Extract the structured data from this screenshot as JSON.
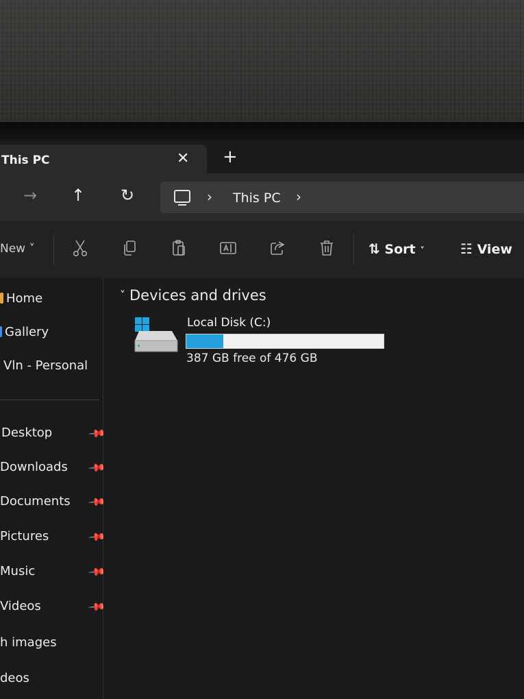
{
  "tab": {
    "title": "This PC",
    "close": "✕",
    "new_tab": "+"
  },
  "nav": {
    "forward": "→",
    "up": "↑",
    "refresh": "↻"
  },
  "address": {
    "crumb": "This PC",
    "sep": "›"
  },
  "commands": {
    "new_label": "New ˅",
    "sort_label": "Sort",
    "view_label": "View"
  },
  "sidebar": {
    "top": [
      {
        "label": "Home",
        "icon": "home-icon",
        "color": "#e8a43a"
      },
      {
        "label": "Gallery",
        "icon": "gallery-icon",
        "color": "#3a8ee8"
      },
      {
        "label": "Vln - Personal",
        "icon": "cloud-icon",
        "color": "#3a8ee8"
      }
    ],
    "pinned": [
      {
        "label": "Desktop"
      },
      {
        "label": "Downloads"
      },
      {
        "label": "Documents"
      },
      {
        "label": "Pictures"
      },
      {
        "label": "Music"
      },
      {
        "label": "Videos"
      },
      {
        "label": "h images"
      },
      {
        "label": "deos"
      }
    ]
  },
  "content": {
    "group_title": "Devices and drives",
    "drive": {
      "name": "Local Disk (C:)",
      "free_text": "387 GB free of 476 GB",
      "used_fraction": 0.187
    }
  },
  "colors": {
    "accent": "#26a0da"
  }
}
